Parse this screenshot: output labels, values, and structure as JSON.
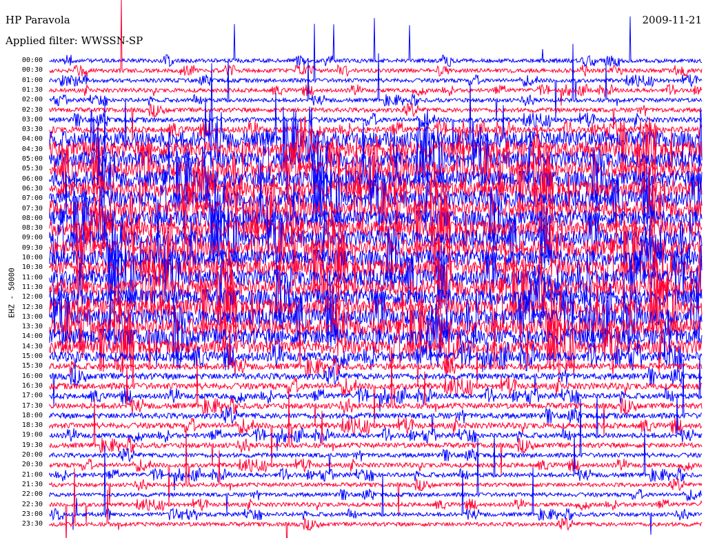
{
  "header": {
    "station": "HP Paravola",
    "filter": "Applied filter: WWSSN-SP",
    "date": "2009-11-21"
  },
  "chart_data": {
    "type": "line",
    "title": "HP Paravola",
    "channel_label": "EHZ - 50000",
    "row_labels": [
      "00:00",
      "00:30",
      "01:00",
      "01:30",
      "02:00",
      "02:30",
      "03:00",
      "03:30",
      "04:00",
      "04:30",
      "05:00",
      "05:30",
      "06:00",
      "06:30",
      "07:00",
      "07:30",
      "08:00",
      "08:30",
      "09:00",
      "09:30",
      "10:00",
      "10:30",
      "11:00",
      "11:30",
      "12:00",
      "12:30",
      "13:00",
      "13:30",
      "14:00",
      "14:30",
      "15:00",
      "15:30",
      "16:00",
      "16:30",
      "17:00",
      "17:30",
      "18:00",
      "18:30",
      "19:00",
      "19:30",
      "20:00",
      "20:30",
      "21:00",
      "21:30",
      "22:00",
      "22:30",
      "23:00",
      "23:30"
    ],
    "activity_level": [
      0.3,
      0.3,
      0.3,
      0.3,
      0.3,
      0.35,
      0.4,
      0.5,
      1,
      1,
      1,
      1,
      1,
      1,
      1,
      1,
      1,
      1,
      1,
      1,
      1,
      1,
      1,
      1,
      1,
      1,
      1,
      1,
      1,
      0.9,
      0.7,
      0.5,
      0.5,
      0.5,
      0.45,
      0.45,
      0.45,
      0.45,
      0.4,
      0.4,
      0.35,
      0.35,
      0.35,
      0.3,
      0.3,
      0.3,
      0.3,
      0.3
    ],
    "colors": {
      "even_rows": "#0000ff",
      "odd_rows": "#ff0033"
    }
  }
}
